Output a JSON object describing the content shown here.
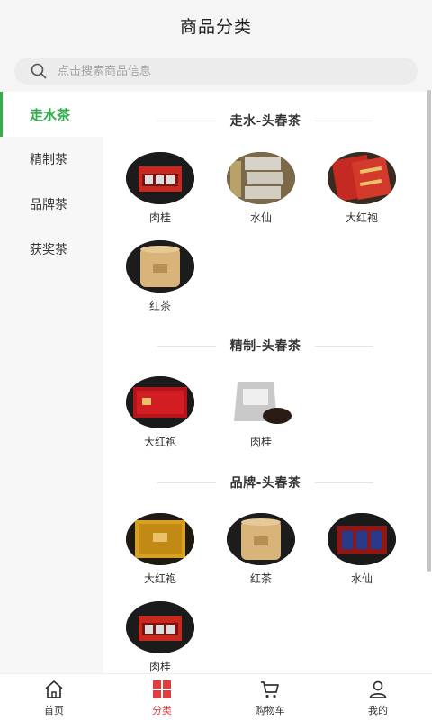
{
  "header": {
    "title": "商品分类"
  },
  "search": {
    "placeholder": "点击搜索商品信息"
  },
  "sidebar": {
    "items": [
      {
        "label": "走水茶",
        "active": true
      },
      {
        "label": "精制茶",
        "active": false
      },
      {
        "label": "品牌茶",
        "active": false
      },
      {
        "label": "获奖茶",
        "active": false
      }
    ]
  },
  "sections": [
    {
      "title": "走水-头春茶",
      "products": [
        {
          "name": "肉桂",
          "icon": "red-gift-box-image"
        },
        {
          "name": "水仙",
          "icon": "paper-tea-packs-image"
        },
        {
          "name": "大红袍",
          "icon": "red-tins-image"
        },
        {
          "name": "红茶",
          "icon": "kraft-tube-image"
        }
      ]
    },
    {
      "title": "精制-头春茶",
      "products": [
        {
          "name": "大红袍",
          "icon": "red-box-image"
        },
        {
          "name": "肉桂",
          "icon": "silver-bag-image"
        }
      ]
    },
    {
      "title": "品牌-头春茶",
      "products": [
        {
          "name": "大红袍",
          "icon": "gold-box-image"
        },
        {
          "name": "红茶",
          "icon": "kraft-tube-image"
        },
        {
          "name": "水仙",
          "icon": "blue-tins-image"
        },
        {
          "name": "肉桂",
          "icon": "red-gift-box-image"
        }
      ]
    }
  ],
  "tabbar": {
    "tabs": [
      {
        "label": "首页",
        "icon": "home-icon",
        "active": false
      },
      {
        "label": "分类",
        "icon": "category-icon",
        "active": true
      },
      {
        "label": "购物车",
        "icon": "cart-icon",
        "active": false
      },
      {
        "label": "我的",
        "icon": "user-icon",
        "active": false
      }
    ]
  },
  "colors": {
    "accent_green": "#2fae4a",
    "accent_red": "#e33c3c"
  }
}
